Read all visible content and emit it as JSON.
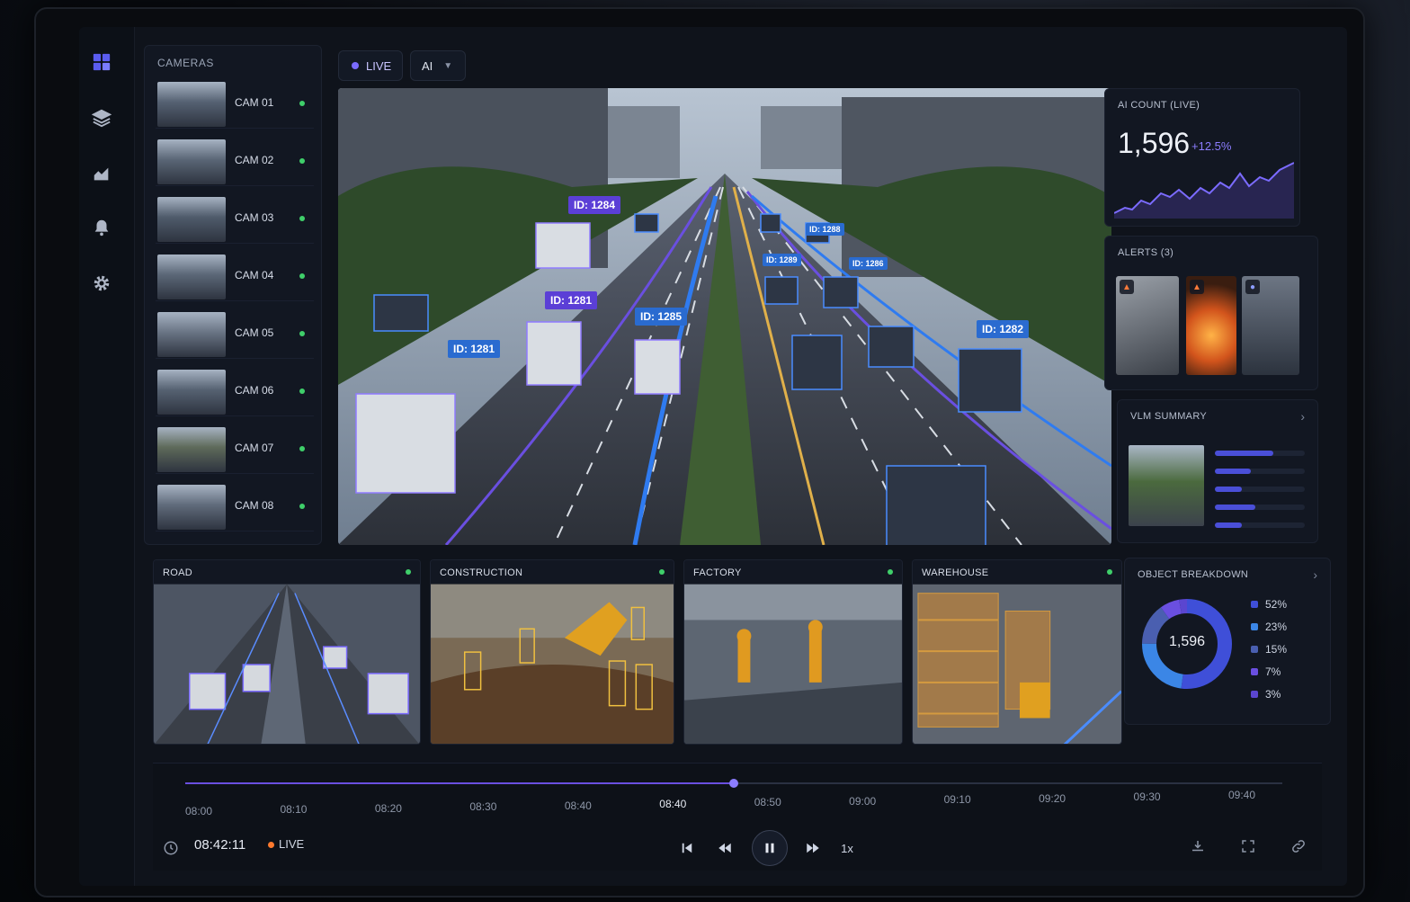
{
  "rail": {
    "items": [
      {
        "name": "dashboard",
        "icon": "dashboard-icon",
        "active": true
      },
      {
        "name": "layers",
        "icon": "layers-icon"
      },
      {
        "name": "analytics",
        "icon": "analytics-icon"
      },
      {
        "name": "alerts",
        "icon": "bell-icon"
      },
      {
        "name": "settings",
        "icon": "gear-icon"
      }
    ]
  },
  "cameras": {
    "title": "CAMERAS",
    "items": [
      {
        "label": "CAM 01",
        "status": "online"
      },
      {
        "label": "CAM 02",
        "status": "online"
      },
      {
        "label": "CAM 03",
        "status": "online"
      },
      {
        "label": "CAM 04",
        "status": "online"
      },
      {
        "label": "CAM 05",
        "status": "online"
      },
      {
        "label": "CAM 06",
        "status": "online"
      },
      {
        "label": "CAM 07",
        "status": "online"
      },
      {
        "label": "CAM 08",
        "status": "online"
      }
    ]
  },
  "top": {
    "live_label": "LIVE",
    "mode_value": "AI"
  },
  "main_video": {
    "tags": [
      {
        "text": "ID: 1284",
        "color": "purple"
      },
      {
        "text": "ID: 1281",
        "color": "purple"
      },
      {
        "text": "ID: 1281",
        "color": "blue"
      },
      {
        "text": "ID: 1285",
        "color": "blue"
      },
      {
        "text": "ID: 1288",
        "color": "blue"
      },
      {
        "text": "ID: 1289",
        "color": "blue"
      },
      {
        "text": "ID: 1286",
        "color": "blue"
      },
      {
        "text": "ID: 1282",
        "color": "blue"
      }
    ]
  },
  "ai_count": {
    "title": "AI COUNT (LIVE)",
    "value": "1,596",
    "delta": "+12.5%"
  },
  "alerts": {
    "title": "ALERTS (3)",
    "items": [
      {
        "kind": "vehicle-crash",
        "icon": "fire-icon"
      },
      {
        "kind": "fire",
        "icon": "fire-icon"
      },
      {
        "kind": "crowd",
        "icon": "people-icon"
      }
    ]
  },
  "vlm": {
    "title": "VLM SUMMARY",
    "bars": [
      0.65,
      0.4,
      0.3,
      0.45,
      0.3
    ]
  },
  "feeds": [
    {
      "title": "ROAD"
    },
    {
      "title": "CONSTRUCTION"
    },
    {
      "title": "FACTORY"
    },
    {
      "title": "WAREHOUSE"
    }
  ],
  "breakdown": {
    "title": "OBJECT BREAKDOWN",
    "center": "1,596",
    "items": [
      {
        "label": "52%",
        "value": 52,
        "color": "#3f4fd8"
      },
      {
        "label": "23%",
        "value": 23,
        "color": "#3b86e6"
      },
      {
        "label": "15%",
        "value": 15,
        "color": "#4a5fb0"
      },
      {
        "label": "7%",
        "value": 7,
        "color": "#6a4fe0"
      },
      {
        "label": "3%",
        "value": 3,
        "color": "#5b46d0"
      }
    ]
  },
  "timeline": {
    "ticks": [
      "08:00",
      "08:10",
      "08:20",
      "08:30",
      "08:40",
      "08:40",
      "08:50",
      "09:00",
      "09:10",
      "09:20",
      "09:30",
      "09:40"
    ],
    "active_tick": 5,
    "progress": 0.5,
    "clock": "08:42:11",
    "live_label": "LIVE",
    "speed": "1x"
  }
}
